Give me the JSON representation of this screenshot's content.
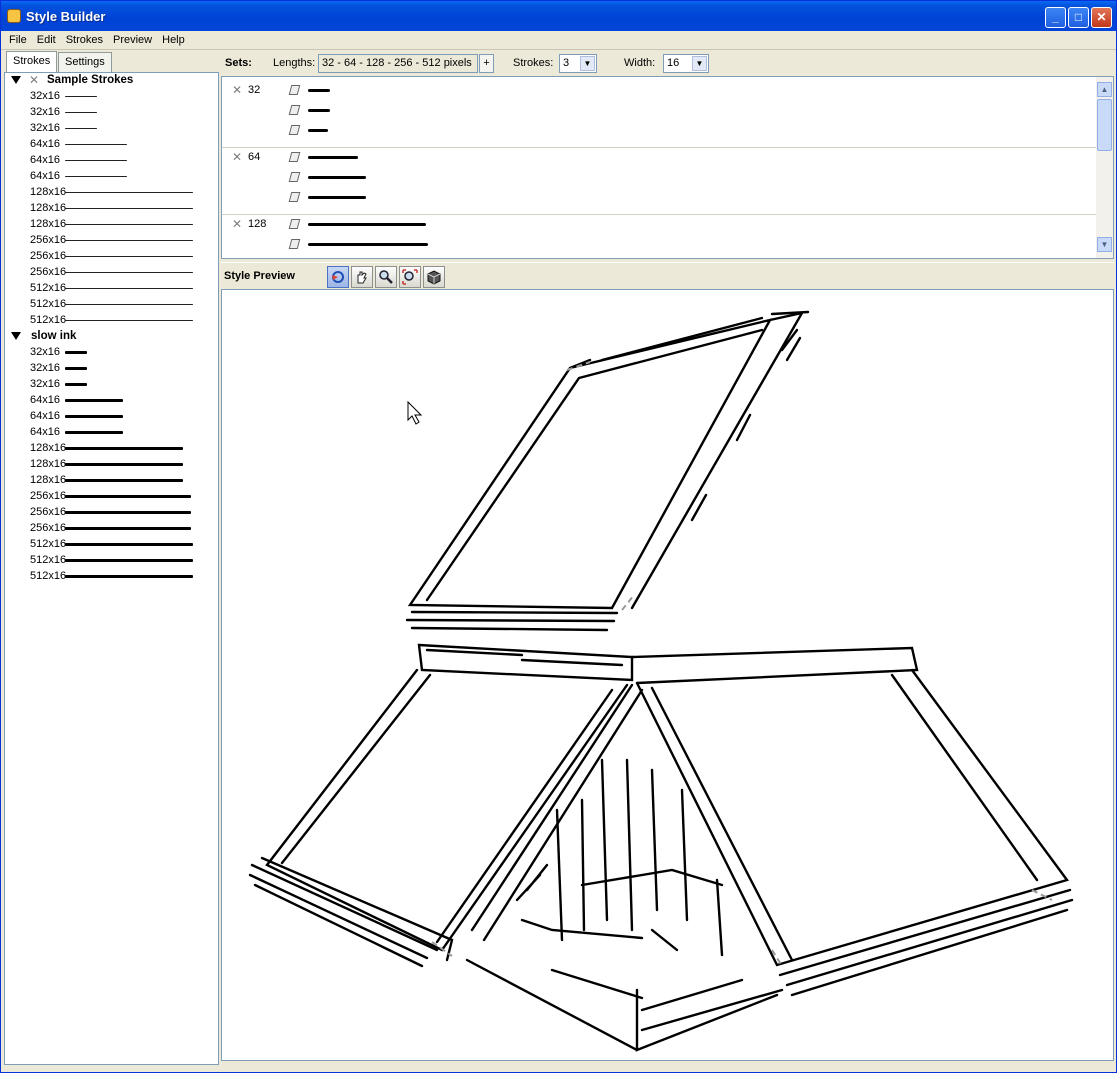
{
  "window": {
    "title": "Style Builder"
  },
  "menu": [
    "File",
    "Edit",
    "Strokes",
    "Preview",
    "Help"
  ],
  "left_tabs": [
    "Strokes",
    "Settings"
  ],
  "stroke_groups": [
    {
      "name": "Sample Strokes",
      "type": "thin",
      "items": [
        "32x16",
        "32x16",
        "32x16",
        "64x16",
        "64x16",
        "64x16",
        "128x16",
        "128x16",
        "128x16",
        "256x16",
        "256x16",
        "256x16",
        "512x16",
        "512x16",
        "512x16"
      ]
    },
    {
      "name": "slow ink",
      "type": "ink",
      "items": [
        "32x16",
        "32x16",
        "32x16",
        "64x16",
        "64x16",
        "64x16",
        "128x16",
        "128x16",
        "128x16",
        "256x16",
        "256x16",
        "256x16",
        "512x16",
        "512x16",
        "512x16"
      ]
    }
  ],
  "sets_bar": {
    "sets_label": "Sets:",
    "lengths_label": "Lengths:",
    "lengths_value": "32 - 64 - 128 - 256 - 512 pixels",
    "plus": "+",
    "strokes_label": "Strokes:",
    "strokes_value": "3",
    "width_label": "Width:",
    "width_value": "16"
  },
  "sets": [
    {
      "length": "32",
      "strokes": 3
    },
    {
      "length": "64",
      "strokes": 3
    },
    {
      "length": "128",
      "strokes": 2
    }
  ],
  "preview": {
    "title": "Style Preview",
    "tools": [
      "orbit-icon",
      "pan-icon",
      "zoom-icon",
      "zoom-extents-icon",
      "display-style-icon"
    ]
  }
}
